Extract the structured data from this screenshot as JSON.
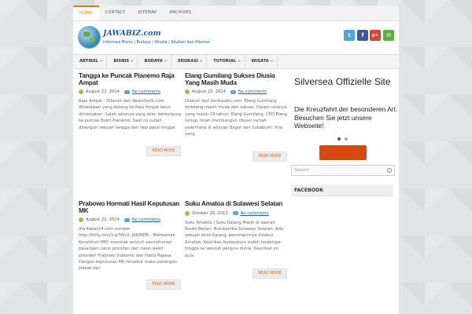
{
  "topnav": [
    "HOME",
    "CONTACT",
    "SITEMAP",
    "ARCHIVES"
  ],
  "header": {
    "title": "JAWABIZ.com",
    "tagline": "Informasi Bisnis | Budaya | Wisata | Edukasi dan Hiburan",
    "social": [
      {
        "name": "twitter-icon",
        "glyph": "t",
        "color": "#48a8dc"
      },
      {
        "name": "facebook-icon",
        "glyph": "f",
        "color": "#3b5998"
      },
      {
        "name": "googleplus-icon",
        "glyph": "g+",
        "color": "#d34836"
      },
      {
        "name": "email-icon",
        "glyph": "✉",
        "color": "#59b33b"
      }
    ]
  },
  "mainnav": [
    {
      "label": "ARTIKEL",
      "arrow": "»"
    },
    {
      "label": "BISNIS",
      "arrow": "»"
    },
    {
      "label": "BUDAYA",
      "arrow": "»"
    },
    {
      "label": "EDUKASI",
      "arrow": "»"
    },
    {
      "label": "TUTORIAL",
      "arrow": "»"
    },
    {
      "label": "WISATA",
      "arrow": "»"
    }
  ],
  "posts": [
    {
      "title": "Tangga ke Puncak Pianemo Raja Ampat",
      "date": "August 22, 2014",
      "comments": "No comments",
      "excerpt": "Raja Ampat - Dilansir dari NewsDetik.com. Wisatawan yang datang ke Raja Ampat terus dimanjakan. Salah satunya yang akan berkunjung ke puncak Bukit Pianemo. Saat ini sudah dibangun sebuah tangga dari tepi patai hingga",
      "readmore": "READ MORE"
    },
    {
      "title": "Elang Gumilang Sukses Diusia Yang Masih Muda",
      "date": "August 22, 2014",
      "comments": "No comments",
      "excerpt": "Dilansir dari beritasatu.com. Elang Gumilang terbilang masih muda dan sukses. Dalam usianya yang masih 29 tahun, Elang Gumilang, CEO Elang Group, telah membangun ribuan rumah sederhana di wilayah Bogor dan Sukabumi. Pria yang",
      "readmore": "READ MORE"
    },
    {
      "title": "Prabowo Hormati Hasil Keputusan MK",
      "date": "August 22, 2014",
      "comments": "No comments",
      "excerpt": "Via Kabar24.com sumber http://bitly.com/1rp7Wv2. JAKARTA - Mahkamah Konstitusi (MK) menolak seluruh permohonan pasangan calon presiden dan calon wakil presiden Prabowo Subianto dan Hatta Rajasa. Dengan keputusan MK tersebut maka pasangan Jokowi dan",
      "readmore": "READ MORE"
    },
    {
      "title": "Suku Amatoa di Sulawesi Selatan",
      "date": "October 25, 2013",
      "comments": "No comments",
      "excerpt": "Suku Amatoa / Suku Kajang Masih di daerah Bonto Bahari, Bulukamba Sulawesi Selatan. Ada sebuah etnis Kajang, pemimpinnya disebut Amatoa. Keunikan budayanya sudah terdengar hingga ke seluruh penjuru dunia. Keunikan ini pula",
      "readmore": "READ MORE"
    }
  ],
  "sidebar": {
    "ad_title": "Silversea Offizielle Site",
    "ad_text": "Die Kreuzfahrt der besonderen Art. Besuchen Sie jetzt unsere Webseite!",
    "ad_button_color": "#d9480f",
    "search_placeholder": "Search",
    "facebook_heading": "FACEBOOK"
  },
  "colors": {
    "accent": "#e07b1a",
    "link": "#1a5fb4",
    "brand": "#1d5f9a"
  }
}
